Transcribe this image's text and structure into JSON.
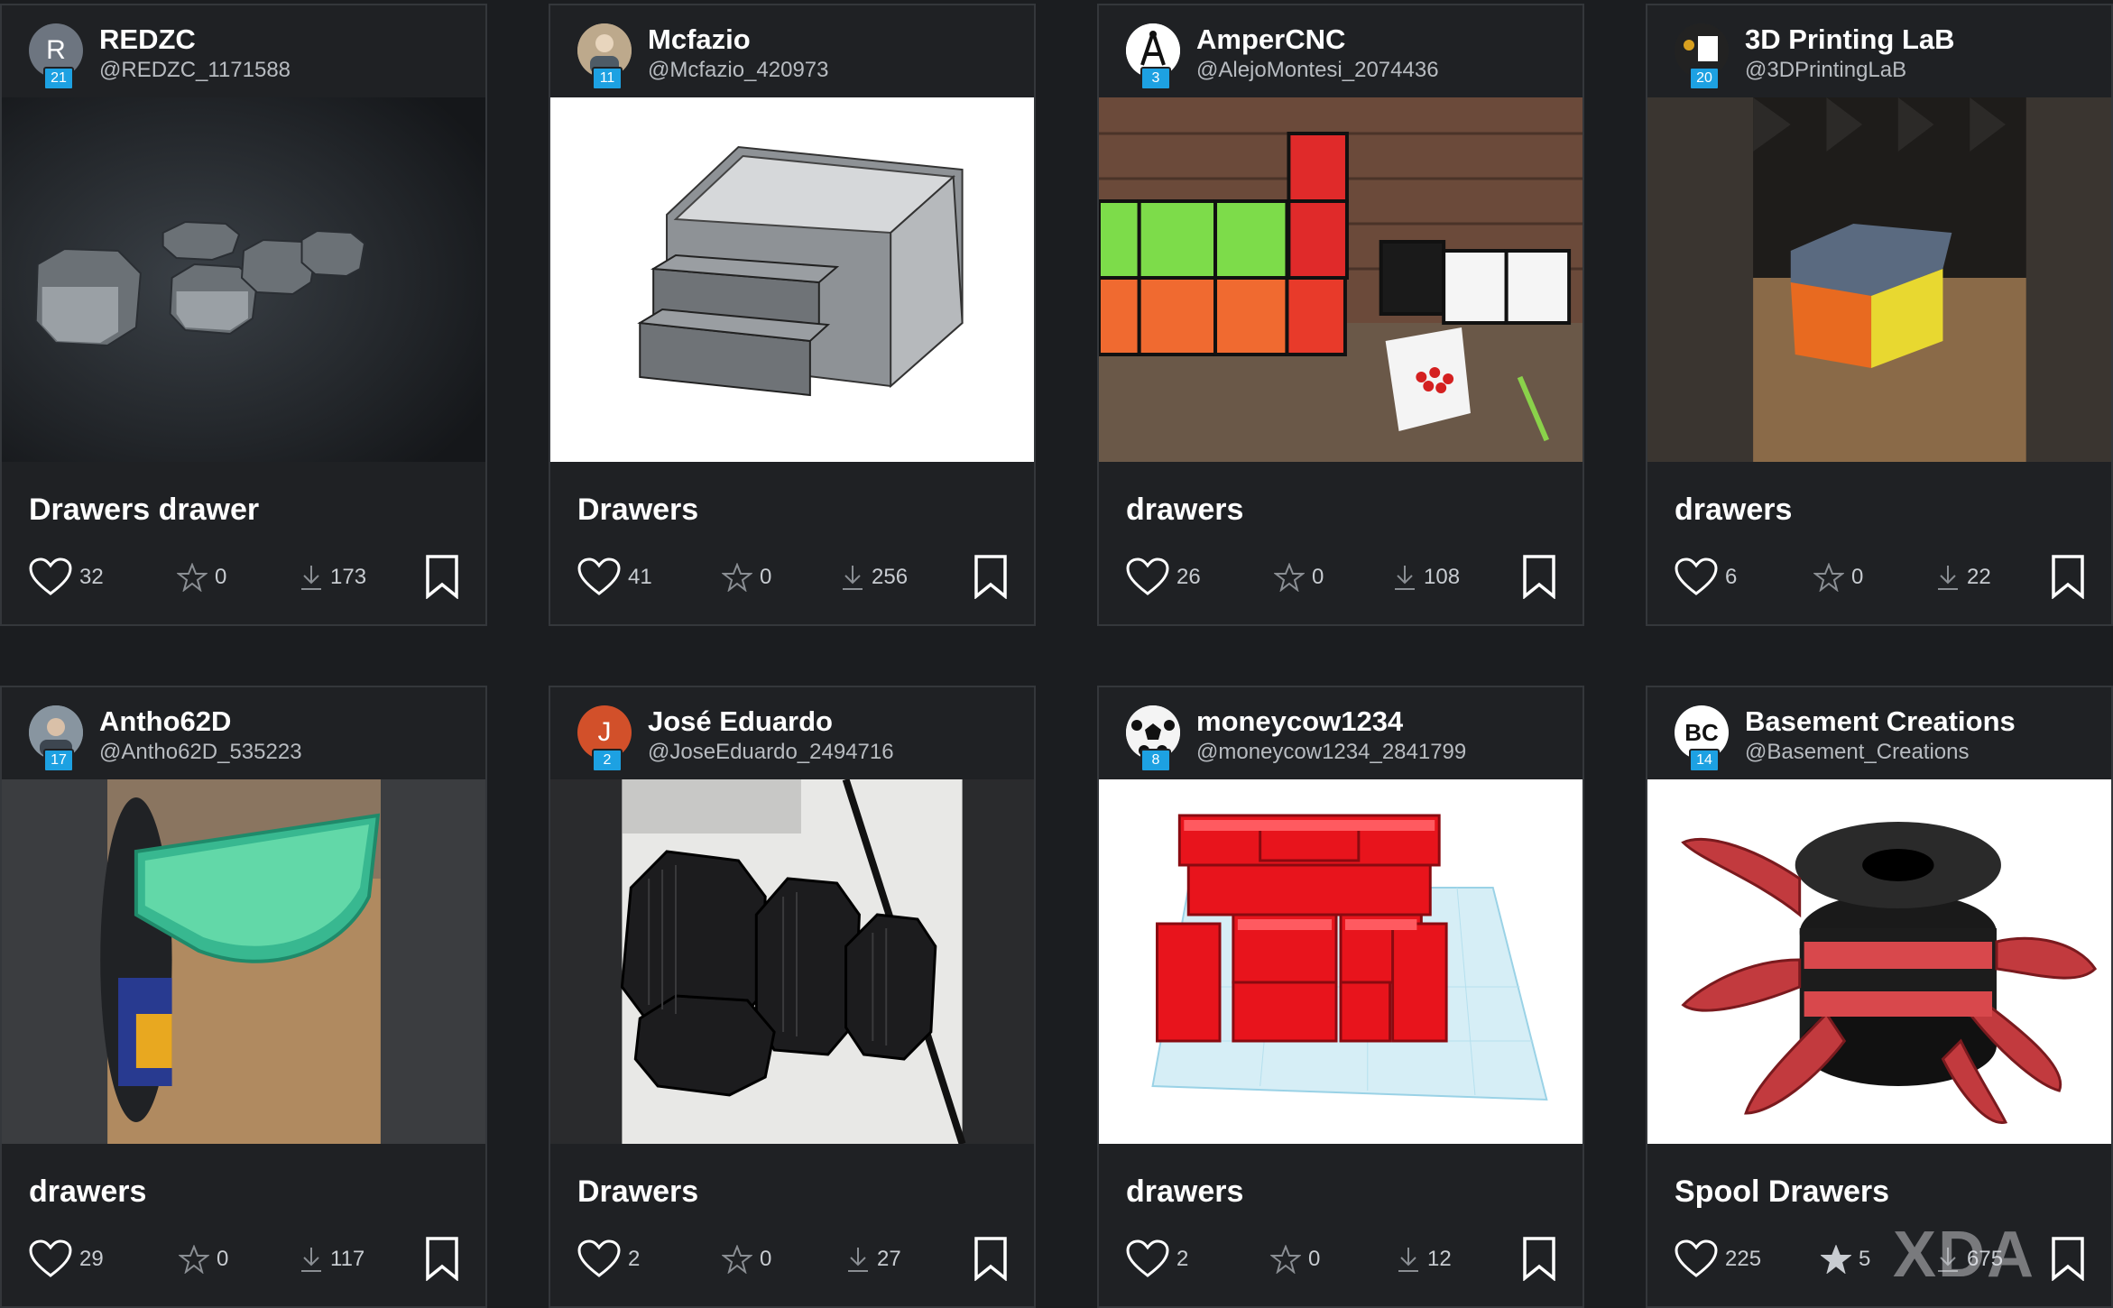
{
  "cards": [
    {
      "user": {
        "name": "REDZC",
        "handle": "@REDZC_1171588",
        "level": "21",
        "initial": "R",
        "avatar_color": "#6d7580"
      },
      "title": "Drawers drawer",
      "likes": "32",
      "stars": "0",
      "downloads": "173",
      "image": "gray hexagonal drawer modules rendered on a dark background",
      "media_bg": "#1a1c1f"
    },
    {
      "user": {
        "name": "Mcfazio",
        "handle": "@Mcfazio_420973",
        "level": "11",
        "initial": "",
        "avatar_color": "#a08a70"
      },
      "title": "Drawers",
      "likes": "41",
      "stars": "0",
      "downloads": "256",
      "image": "gray CAD render of a box with two pull-out drawers",
      "media_bg": "#ffffff"
    },
    {
      "user": {
        "name": "AmperCNC",
        "handle": "@AlejoMontesi_2074436",
        "level": "3",
        "initial": "",
        "avatar_color": "#ffffff"
      },
      "title": "drawers",
      "likes": "26",
      "stars": "0",
      "downloads": "108",
      "image": "photo of colorful modular printed drawers in front of a brick wall",
      "media_bg": "#5a4032"
    },
    {
      "user": {
        "name": "3D Printing LaB",
        "handle": "@3DPrintingLaB",
        "level": "20",
        "initial": "",
        "avatar_color": "#2a2a2a"
      },
      "title": "drawers",
      "likes": "6",
      "stars": "0",
      "downloads": "22",
      "image": "photo of a small gray box with orange and yellow drawers on a wooden desk",
      "media_bg": "#3a3530"
    },
    {
      "user": {
        "name": "Antho62D",
        "handle": "@Antho62D_535223",
        "level": "17",
        "initial": "",
        "avatar_color": "#7a8a96"
      },
      "title": "drawers",
      "likes": "29",
      "stars": "0",
      "downloads": "117",
      "image": "photo of a translucent green curved drawer mounted on a filament spool",
      "media_bg": "#3b3d40"
    },
    {
      "user": {
        "name": "José Eduardo",
        "handle": "@JoseEduardo_2494716",
        "level": "2",
        "initial": "J",
        "avatar_color": "#d2502a"
      },
      "title": "Drawers",
      "likes": "2",
      "stars": "0",
      "downloads": "27",
      "image": "photo of black hexagonal printed drawer modules on a white table",
      "media_bg": "#2a2b2d"
    },
    {
      "user": {
        "name": "moneycow1234",
        "handle": "@moneycow1234_2841799",
        "level": "8",
        "initial": "",
        "avatar_color": "#f0f0f0"
      },
      "title": "drawers",
      "likes": "2",
      "stars": "0",
      "downloads": "12",
      "image": "Tinkercad render of red drawer organizer on a light blue workplane",
      "media_bg": "#ffffff"
    },
    {
      "user": {
        "name": "Basement Creations",
        "handle": "@Basement_Creations",
        "level": "14",
        "initial": "BC",
        "avatar_color": "#ffffff"
      },
      "title": "Spool Drawers",
      "likes": "225",
      "stars": "5",
      "downloads": "675",
      "image": "render of red swing-out drawers attached to a black spool",
      "media_bg": "#ffffff"
    }
  ],
  "icons": {
    "like": "heart-icon",
    "star": "star-icon",
    "download": "download-icon",
    "save": "bookmark-icon"
  },
  "colors": {
    "page_bg": "#1b1d20",
    "card_bg": "#1f2124",
    "level_badge": "#1da1e2",
    "stat_text": "#c8ccd1"
  },
  "watermark": "XDA"
}
